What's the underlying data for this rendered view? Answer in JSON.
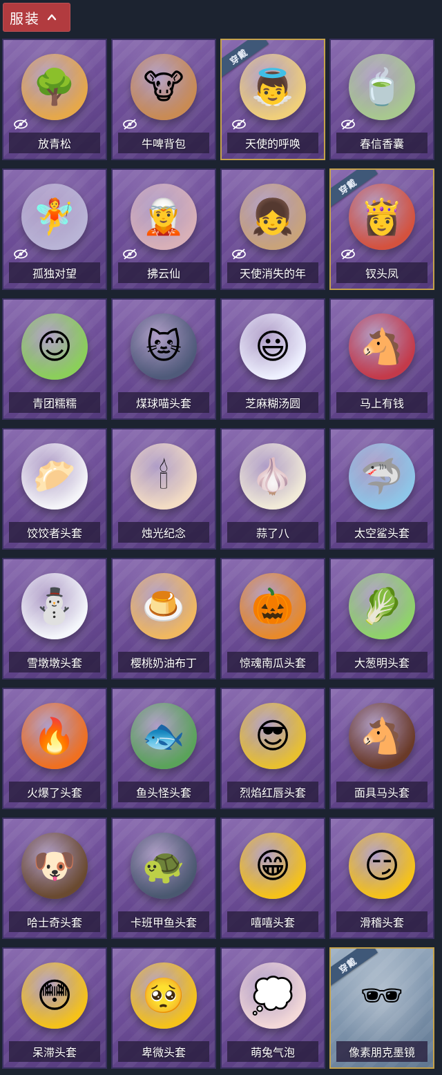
{
  "header": {
    "title": "服装",
    "toggle_icon": "chevron-up-icon"
  },
  "colors": {
    "header_bg": "#b23b3f",
    "card_purple": "#6e4e98",
    "equipped_border": "#c5a24a",
    "ribbon_bg": "#3f5878"
  },
  "items": [
    {
      "label": "放青松",
      "hidden": true,
      "equipped": false,
      "icon": "🌳",
      "bg": "#e6a84a"
    },
    {
      "label": "牛啤背包",
      "hidden": true,
      "equipped": false,
      "icon": "🐮",
      "bg": "#c98b54"
    },
    {
      "label": "天使的呼唤",
      "hidden": true,
      "equipped": true,
      "ribbon": "穿戴",
      "icon": "👼",
      "bg": "#f0cf7a"
    },
    {
      "label": "春信香囊",
      "hidden": true,
      "equipped": false,
      "icon": "🍵",
      "bg": "#a8c88f"
    },
    {
      "label": "孤独对望",
      "hidden": true,
      "equipped": false,
      "icon": "🧚",
      "bg": "#b9b4d6"
    },
    {
      "label": "拂云仙",
      "hidden": true,
      "equipped": false,
      "icon": "🧝",
      "bg": "#d8b0b8"
    },
    {
      "label": "天使消失的年",
      "hidden": true,
      "equipped": false,
      "icon": "👧",
      "bg": "#c9a37a"
    },
    {
      "label": "钗头凤",
      "hidden": true,
      "equipped": true,
      "ribbon": "穿戴",
      "icon": "👸",
      "bg": "#d4523e"
    },
    {
      "label": "青团糯糯",
      "hidden": false,
      "equipped": false,
      "icon": "😊",
      "bg": "#8bcf5a"
    },
    {
      "label": "煤球喵头套",
      "hidden": false,
      "equipped": false,
      "icon": "🐱",
      "bg": "#4f5a7a"
    },
    {
      "label": "芝麻糊汤圆",
      "hidden": false,
      "equipped": false,
      "icon": "😃",
      "bg": "#eef0ff"
    },
    {
      "label": "马上有钱",
      "hidden": false,
      "equipped": false,
      "icon": "🐴",
      "bg": "#c43a4a"
    },
    {
      "label": "饺饺者头套",
      "hidden": false,
      "equipped": false,
      "icon": "🥟",
      "bg": "#f4f4f8"
    },
    {
      "label": "烛光纪念",
      "hidden": false,
      "equipped": false,
      "icon": "🕯",
      "bg": "#f3dcc4"
    },
    {
      "label": "蒜了八",
      "hidden": false,
      "equipped": false,
      "icon": "🧄",
      "bg": "#f1ead8"
    },
    {
      "label": "太空鲨头套",
      "hidden": false,
      "equipped": false,
      "icon": "🦈",
      "bg": "#8ec6e8"
    },
    {
      "label": "雪墩墩头套",
      "hidden": false,
      "equipped": false,
      "icon": "⛄",
      "bg": "#f4f6fb"
    },
    {
      "label": "樱桃奶油布丁",
      "hidden": false,
      "equipped": false,
      "icon": "🍮",
      "bg": "#f0b860"
    },
    {
      "label": "惊魂南瓜头套",
      "hidden": false,
      "equipped": false,
      "icon": "🎃",
      "bg": "#e88a2a"
    },
    {
      "label": "大葱明头套",
      "hidden": false,
      "equipped": false,
      "icon": "🥬",
      "bg": "#8fd36a"
    },
    {
      "label": "火爆了头套",
      "hidden": false,
      "equipped": false,
      "icon": "🔥",
      "bg": "#f07020"
    },
    {
      "label": "鱼头怪头套",
      "hidden": false,
      "equipped": false,
      "icon": "🐟",
      "bg": "#5aa35a"
    },
    {
      "label": "烈焰红唇头套",
      "hidden": false,
      "equipped": false,
      "icon": "😎",
      "bg": "#e8c030"
    },
    {
      "label": "面具马头套",
      "hidden": false,
      "equipped": false,
      "icon": "🐴",
      "bg": "#6a3a28"
    },
    {
      "label": "哈士奇头套",
      "hidden": false,
      "equipped": false,
      "icon": "🐶",
      "bg": "#6a4a30"
    },
    {
      "label": "卡班甲鱼头套",
      "hidden": false,
      "equipped": false,
      "icon": "🐢",
      "bg": "#4a5870"
    },
    {
      "label": "嘻嘻头套",
      "hidden": false,
      "equipped": false,
      "icon": "😁",
      "bg": "#f5c21a"
    },
    {
      "label": "滑稽头套",
      "hidden": false,
      "equipped": false,
      "icon": "😏",
      "bg": "#f5c21a"
    },
    {
      "label": "呆滞头套",
      "hidden": false,
      "equipped": false,
      "icon": "😳",
      "bg": "#f5c21a"
    },
    {
      "label": "卑微头套",
      "hidden": false,
      "equipped": false,
      "icon": "🥺",
      "bg": "#f5c21a"
    },
    {
      "label": "萌兔气泡",
      "hidden": false,
      "equipped": false,
      "icon": "💭",
      "bg": "#f3d8d8"
    },
    {
      "label": "像素朋克墨镜",
      "hidden": false,
      "equipped": true,
      "ribbon": "穿戴",
      "gray": true,
      "icon": "🕶",
      "bg": "#dfe6ee"
    }
  ]
}
